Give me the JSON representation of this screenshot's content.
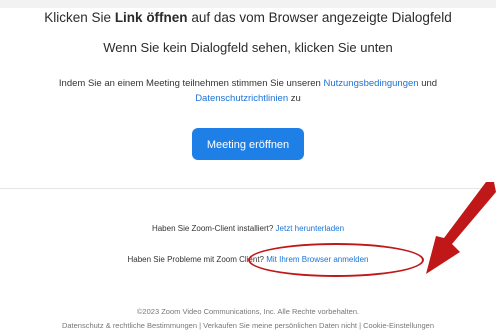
{
  "prompt": {
    "headline_pre": "Klicken Sie ",
    "headline_bold": "Link öffnen",
    "headline_post": " auf das vom Browser angezeigte Dialogfeld",
    "subline": "Wenn Sie kein Dialogfeld sehen, klicken Sie unten"
  },
  "terms": {
    "text_pre": "Indem Sie an einem Meeting teilnehmen stimmen Sie unseren ",
    "terms_link": "Nutzungsbedingungen",
    "text_mid": " und",
    "privacy_link": "Datenschutzrichtlinien",
    "text_post": " zu"
  },
  "open_button": {
    "label": "Meeting eröffnen"
  },
  "client": {
    "download_text": "Haben Sie Zoom-Client installiert? ",
    "download_link": "Jetzt herunterladen",
    "problem_text": "Haben Sie Probleme mit Zoom Client? ",
    "browser_link": "Mit Ihrem Browser anmelden"
  },
  "footer": {
    "copyright": "©2023 Zoom Video Communications, Inc. Alle Rechte vorbehalten.",
    "links": [
      "Datenschutz & rechtliche Bestimmungen",
      "Verkaufen Sie meine persönlichen Daten nicht",
      "Cookie-Einstellungen"
    ],
    "separator": " | "
  },
  "colors": {
    "link": "#1a73d8",
    "button": "#1e7fe6",
    "annotation": "#c01818"
  }
}
